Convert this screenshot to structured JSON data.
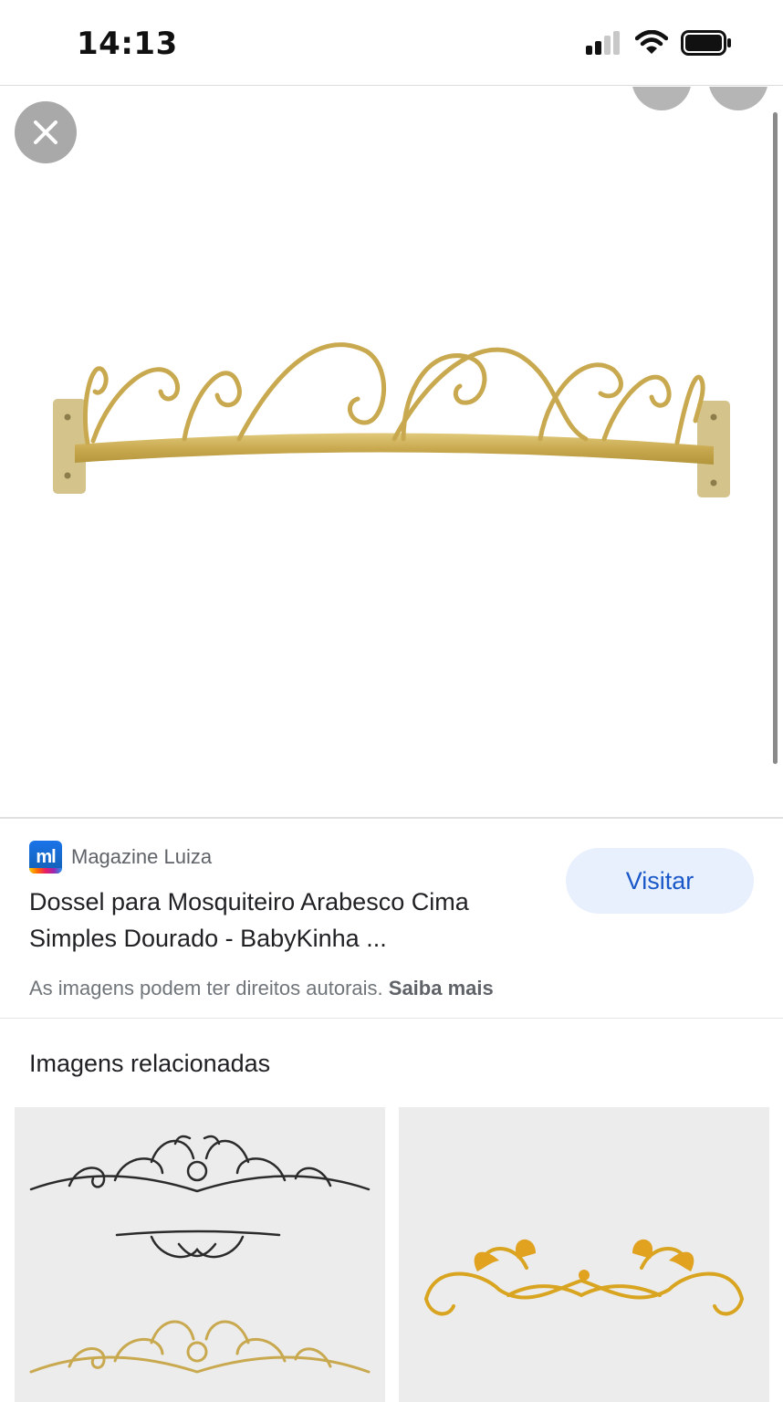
{
  "status_bar": {
    "time": "14:13",
    "icons": [
      "signal-icon",
      "wifi-icon",
      "battery-icon"
    ]
  },
  "viewer": {
    "close_icon": "close-icon",
    "image_alt": "Dossel para Mosquiteiro Arabesco dourado"
  },
  "result": {
    "source_logo_text": "ml",
    "source_name": "Magazine Luiza",
    "title": "Dossel para Mosquiteiro Arabesco Cima Simples Dourado - BabyKinha ...",
    "visit_label": "Visitar",
    "copyright_text": "As imagens podem ter direitos autorais.",
    "learn_more": "Saiba mais"
  },
  "related": {
    "heading": "Imagens relacionadas"
  },
  "colors": {
    "gold": "#c9a94f",
    "visit_bg": "#e8f0fe",
    "visit_text": "#1a57c8"
  }
}
